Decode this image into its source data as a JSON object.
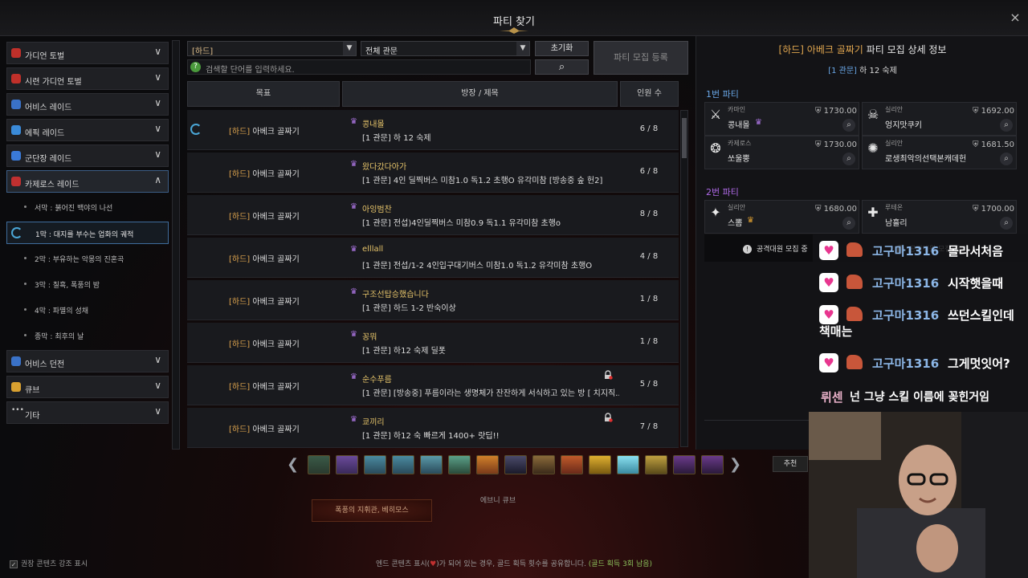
{
  "window": {
    "title": "파티 찾기",
    "close_glyph": "×"
  },
  "sidebar": {
    "categories": [
      {
        "label": "가디언 토벌",
        "icon": "guardian-icon",
        "color": "#c0302a"
      },
      {
        "label": "시련 가디언 토벌",
        "icon": "trial-guardian-icon",
        "color": "#c0302a"
      },
      {
        "label": "어비스 레이드",
        "icon": "abyss-raid-icon",
        "color": "#3a72c8"
      },
      {
        "label": "에픽 레이드",
        "icon": "epic-raid-icon",
        "color": "#3a8ad8"
      },
      {
        "label": "군단장 레이드",
        "icon": "legion-raid-icon",
        "color": "#3a7ad8"
      },
      {
        "label": "카제로스 레이드",
        "icon": "kazeros-raid-icon",
        "color": "#c03030"
      }
    ],
    "sub_items": [
      "서막 : 붉어진 백야의 나선",
      "1막 : 대지를 부수는 업화의 궤적",
      "2막 : 부유하는 악몽의 진혼곡",
      "3막 : 칠흑, 폭풍의 밤",
      "4막 : 파멸의 성채",
      "종막 : 최후의 날"
    ],
    "bottom_categories": [
      {
        "label": "어비스 던전",
        "icon": "abyss-dungeon-icon",
        "color": "#3a72c8"
      },
      {
        "label": "큐브",
        "icon": "cube-icon",
        "color": "#d8a030"
      },
      {
        "label": "기타",
        "icon": "more-icon",
        "color": "#cccccc"
      }
    ]
  },
  "filters": {
    "difficulty": "[하드]",
    "level": "전체 관문",
    "reset_label": "초기화",
    "register_label": "파티 모집 등록",
    "search_placeholder": "검색할 단어를 입력하세요.",
    "help_glyph": "?",
    "search_glyph": "⌕",
    "dropdown_glyph": "▼"
  },
  "table": {
    "headers": [
      "목표",
      "방장 / 제목",
      "인원 수"
    ],
    "goal_prefix": "[하드]",
    "goal_name": "아베크 골짜기",
    "crown_glyph": "♛",
    "rows": [
      {
        "leader": "콩내몰",
        "title": "[1 관문] 하 12 숙제",
        "count": "6 / 8"
      },
      {
        "leader": "왔다갔다아가",
        "title": "[1 관문] 4인 딜찍버스 미참1.0 독1.2 초행O 유각미참 [방송중 숲 헌2]",
        "count": "6 / 8"
      },
      {
        "leader": "아잉범찬",
        "title": "[1 관문] 전섭)4인딜찍버스 미참0.9 독1.1 유각미참 초행o",
        "count": "8 / 8"
      },
      {
        "leader": "elllall",
        "title": "[1 관문] 전섭/1-2 4인입구대기버스 미참1.0 독1.2 유각미참 초행O",
        "count": "4 / 8"
      },
      {
        "leader": "구조선탑승했습니다",
        "title": "[1 관문] 하드 1-2 반숙이상",
        "count": "1 / 8"
      },
      {
        "leader": "꽁뭐",
        "title": "[1 관문] 하12 숙제 딜폿",
        "count": "1 / 8"
      },
      {
        "leader": "순수푸름",
        "title": "[1 관문] [방송중] 푸름이라는 생명체가 잔잔하게 서식하고 있는 방 [ 치지직...",
        "count": "5 / 8"
      },
      {
        "leader": "쿄끼리",
        "title": "[1 관문] 하12 숙 빠르게 1400+ 랏딥!!",
        "count": "7 / 8"
      }
    ]
  },
  "detail": {
    "head_prefix": "[하드] 아베크 골짜기",
    "head_suffix": "파티 모집 상세 정보",
    "sub_prefix": "[1 관문]",
    "sub_suffix": "하 12 숙제",
    "party1_title": "1번 파티",
    "party2_title": "2번 파티",
    "party1": [
      {
        "cls": "카마인",
        "name": "콩내몰",
        "gs": "1730.00"
      },
      {
        "cls": "실리안",
        "name": "엉지맛쿠키",
        "gs": "1692.00"
      },
      {
        "cls": "카제로스",
        "name": "쏘울뿡",
        "gs": "1730.00"
      },
      {
        "cls": "실리안",
        "name": "로생최악의선택본캐데헌",
        "gs": "1681.50"
      }
    ],
    "party2": [
      {
        "cls": "실리안",
        "name": "스뽐",
        "gs": "1680.00"
      },
      {
        "cls": "루테온",
        "name": "남흘리",
        "gs": "1700.00"
      }
    ],
    "recruit_text": "공격대원 모집 중",
    "info_glyph": "!",
    "recommend_label": "추천"
  },
  "bottom": {
    "toggle_label": "권장 콘텐츠 강조 표시",
    "toggle_glyph": "✓",
    "notice_a": "엔드 콘텐츠 표시(",
    "notice_b": ")가 되어 있는 경우, 골드 획득 횟수를 공유합니다.",
    "notice_c": "(골드 획득 3회 남음)",
    "boss_label": "폭풍의 지휘관, 베히모스",
    "cube_label": "에브니 큐브",
    "arrow_left": "❮",
    "arrow_right": "❯"
  },
  "chat": [
    {
      "user": "고구마1316",
      "msg": "몰라서처음"
    },
    {
      "user": "고구마1316",
      "msg": "시작햇을때"
    },
    {
      "user": "고구마1316",
      "msg": "쓰던스킬인데"
    },
    {
      "user": "",
      "msg": "책매는"
    },
    {
      "user": "고구마1316",
      "msg": "그게멋잇어?"
    },
    {
      "user": "뤼센",
      "msg": "넌 그냥 스킬 이름에 꽂힌거임"
    }
  ],
  "colors": {
    "accent_gold": "#e0a64f",
    "leader_yellow": "#e6c46a",
    "party_blue": "#6aa8e8",
    "party2_purple": "#b06ae8"
  }
}
